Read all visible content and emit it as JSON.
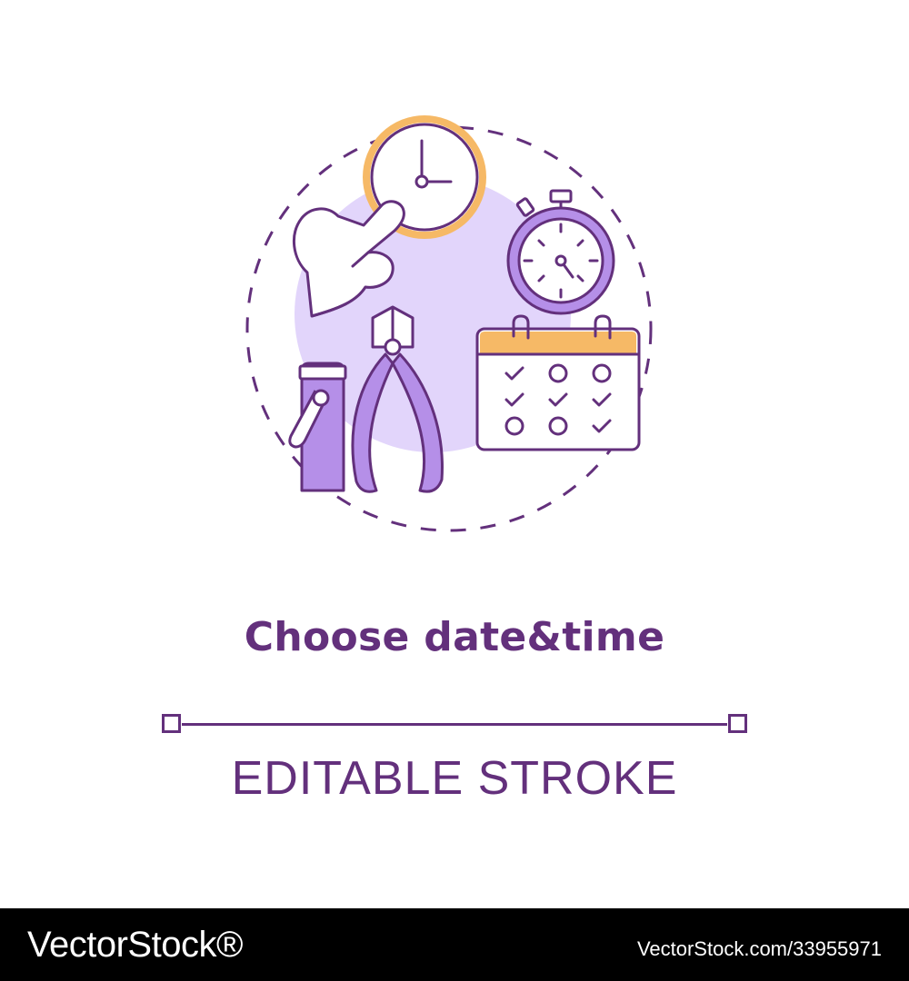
{
  "colors": {
    "primary": "#63307c",
    "accent": "#f6b966",
    "fill": "#e2d5fb",
    "fill_dark": "#b58fe8",
    "background": "#ffffff",
    "footer_background": "#000000"
  },
  "illustration": {
    "icons": [
      "wall-clock-icon",
      "pointing-hand-icon",
      "stopwatch-icon",
      "calendar-icon",
      "nail-clipper-icon",
      "cuticle-nipper-icon"
    ],
    "calendar_marks": [
      [
        "check",
        "circle",
        "circle"
      ],
      [
        "check",
        "check",
        "check"
      ],
      [
        "circle",
        "circle",
        "check"
      ]
    ]
  },
  "title": "Choose date&time",
  "subtitle": "EDITABLE STROKE",
  "footer": {
    "logo": "VectorStock®",
    "credit": "VectorStock.com/33955971"
  }
}
